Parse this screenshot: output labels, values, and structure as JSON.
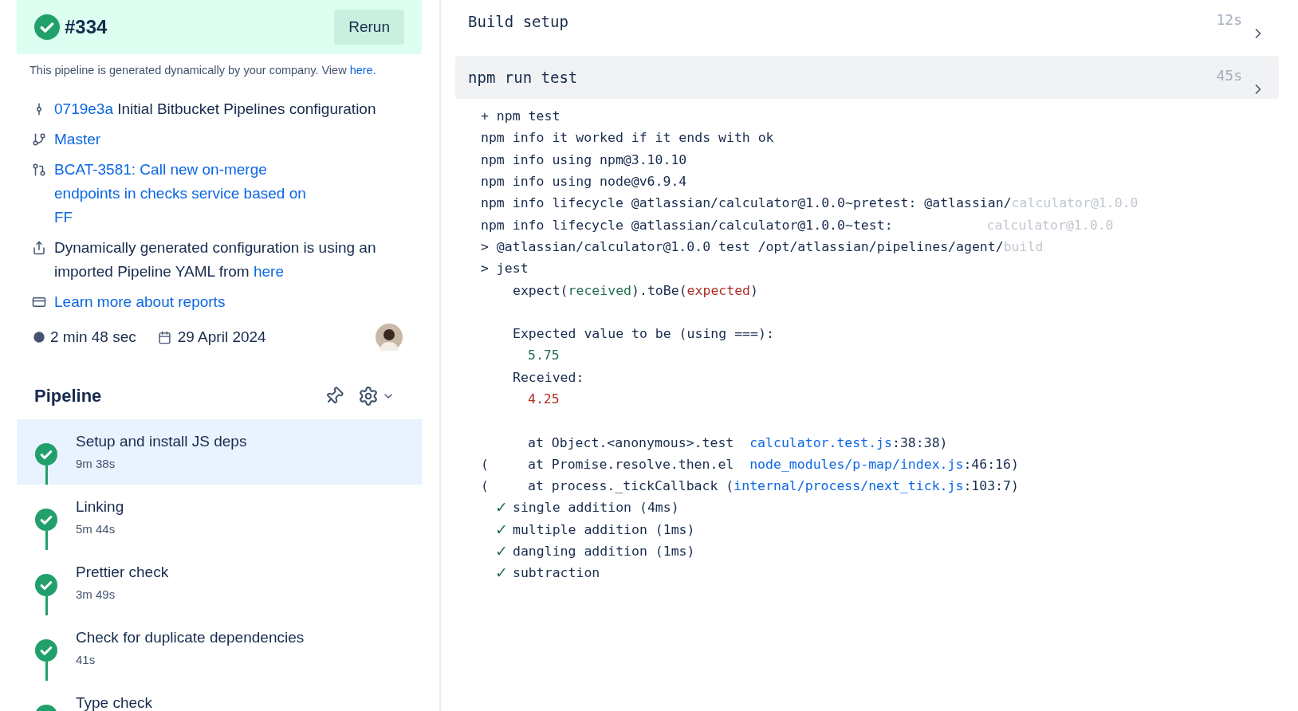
{
  "build": {
    "number": "#334",
    "action": "Rerun"
  },
  "notice": [
    {
      "text": "This pipeline is generated dynamically by your company. View ",
      "kind": "text"
    },
    {
      "text": "here.",
      "kind": "link"
    }
  ],
  "meta": [
    {
      "kind": "commit",
      "parts": [
        {
          "text": "0719e3a",
          "kind": "link"
        },
        {
          "text": " Initial Bitbucket Pipelines configuration",
          "kind": "text"
        }
      ]
    },
    {
      "kind": "branch",
      "parts": [
        {
          "text": "Master",
          "kind": "link"
        }
      ]
    },
    {
      "kind": "pull_request",
      "parts": [
        {
          "text": "BCAT-3581: Call new on-merge endpoints in checks service based on FF",
          "kind": "link"
        }
      ]
    },
    {
      "kind": "imported",
      "parts": [
        {
          "text": "Dynamically generated configuration is using an imported Pipeline YAML from ",
          "kind": "text"
        },
        {
          "text": "here",
          "kind": "link"
        }
      ]
    },
    {
      "kind": "reports",
      "parts": [
        {
          "text": "Learn more about reports",
          "kind": "link"
        }
      ]
    }
  ],
  "duration": "2 min 48 sec",
  "date": "29 April 2024",
  "pipeline": {
    "title": "Pipeline",
    "steps": [
      {
        "name": "Setup and install JS deps",
        "duration": "9m 38s",
        "selected": true
      },
      {
        "name": "Linking",
        "duration": "5m 44s",
        "selected": false
      },
      {
        "name": "Prettier check",
        "duration": "3m 49s",
        "selected": false
      },
      {
        "name": "Check for duplicate dependencies",
        "duration": "41s",
        "selected": false
      },
      {
        "name": "Type check",
        "selected": false
      }
    ]
  },
  "log_sections": [
    {
      "title": "Build setup",
      "duration": "12s",
      "expanded": false
    },
    {
      "title": "npm run test",
      "duration": "45s",
      "expanded": true,
      "lines": [
        {
          "kind": "command",
          "parts": [
            {
              "text": "+ npm test",
              "kind": "plain"
            }
          ]
        },
        {
          "kind": "command",
          "parts": [
            {
              "text": "npm info it worked if it ends with ok",
              "kind": "plain"
            }
          ]
        },
        {
          "kind": "command",
          "parts": [
            {
              "text": "npm info using npm@3.10.10",
              "kind": "plain"
            }
          ]
        },
        {
          "kind": "command",
          "parts": [
            {
              "text": "npm info using node@v6.9.4",
              "kind": "plain"
            }
          ]
        },
        {
          "kind": "command",
          "parts": [
            {
              "text": "npm info lifecycle @atlassian/calculator@1.0.0~pretest: @atlassian/",
              "kind": "plain"
            },
            {
              "text": "calculator@1.0.0",
              "kind": "faded"
            }
          ]
        },
        {
          "kind": "command",
          "parts": [
            {
              "text": "npm info lifecycle @atlassian/calculator@1.0.0~test:",
              "kind": "plain"
            },
            {
              "text": "calculator@1.0.0",
              "kind": "offset"
            }
          ]
        },
        {
          "kind": "command",
          "parts": [
            {
              "text": "> @atlassian/calculator@1.0.0 test /opt/atlassian/pipelines/agent/",
              "kind": "plain"
            },
            {
              "text": "build",
              "kind": "faded"
            }
          ]
        },
        {
          "kind": "command",
          "parts": [
            {
              "text": "> jest",
              "kind": "plain"
            }
          ]
        },
        {
          "kind": "detail",
          "parts": [
            {
              "text": "expect(",
              "kind": "plain"
            },
            {
              "text": "received",
              "kind": "green"
            },
            {
              "text": ").toBe(",
              "kind": "plain"
            },
            {
              "text": "expected",
              "kind": "red"
            },
            {
              "text": ")",
              "kind": "plain"
            }
          ]
        },
        {
          "kind": "blank"
        },
        {
          "kind": "detail",
          "parts": [
            {
              "text": "Expected value to be (using ===):",
              "kind": "plain"
            }
          ]
        },
        {
          "kind": "value",
          "parts": [
            {
              "text": "5.75",
              "kind": "green"
            }
          ]
        },
        {
          "kind": "detail",
          "parts": [
            {
              "text": "Received:",
              "kind": "plain"
            }
          ]
        },
        {
          "kind": "value",
          "parts": [
            {
              "text": "4.25",
              "kind": "red"
            }
          ]
        },
        {
          "kind": "blank"
        },
        {
          "kind": "stack",
          "parts": [
            {
              "text": "at Object.<anonymous>.test  ",
              "kind": "plain"
            },
            {
              "text": "calculator.test.js",
              "kind": "link"
            },
            {
              "text": ":38:38)",
              "kind": "plain"
            }
          ]
        },
        {
          "kind": "stack",
          "prefix": "(",
          "parts": [
            {
              "text": "at Promise.resolve.then.el  ",
              "kind": "plain"
            },
            {
              "text": "node_modules/p-map/index.js",
              "kind": "link"
            },
            {
              "text": ":46:16)",
              "kind": "plain"
            }
          ]
        },
        {
          "kind": "stack",
          "prefix": "(",
          "parts": [
            {
              "text": "at process._tickCallback (",
              "kind": "plain"
            },
            {
              "text": "internal/process/next_tick.js",
              "kind": "link"
            },
            {
              "text": ":103:7)",
              "kind": "plain"
            }
          ]
        },
        {
          "kind": "pass",
          "mark": "✓",
          "parts": [
            {
              "text": "single addition (4ms)",
              "kind": "plain"
            }
          ]
        },
        {
          "kind": "pass",
          "mark": "✓",
          "parts": [
            {
              "text": "multiple addition (1ms)",
              "kind": "plain"
            }
          ]
        },
        {
          "kind": "pass",
          "mark": "✓",
          "parts": [
            {
              "text": "dangling addition (1ms)",
              "kind": "plain"
            }
          ]
        },
        {
          "kind": "pass",
          "mark": "✓",
          "parts": [
            {
              "text": "subtraction",
              "kind": "plain"
            }
          ]
        }
      ]
    }
  ]
}
